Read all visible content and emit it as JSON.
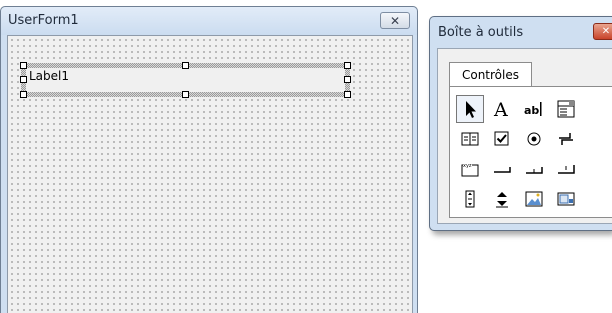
{
  "userform": {
    "title": "UserForm1",
    "close_icon": "close-icon",
    "label": {
      "text": "Label1"
    }
  },
  "toolbox": {
    "title": "Boîte à outils",
    "close_icon": "close-icon",
    "tab": "Contrôles",
    "tools": [
      "pointer-icon",
      "label-icon",
      "textbox-icon",
      "combobox-icon",
      "listbox-icon",
      "checkbox-icon",
      "optionbutton-icon",
      "togglebutton-icon",
      "frame-icon",
      "commandbutton-icon",
      "tabstrip-icon",
      "multipage-icon",
      "scrollbar-icon",
      "spinbutton-icon",
      "image-icon",
      "refedit-icon"
    ]
  }
}
